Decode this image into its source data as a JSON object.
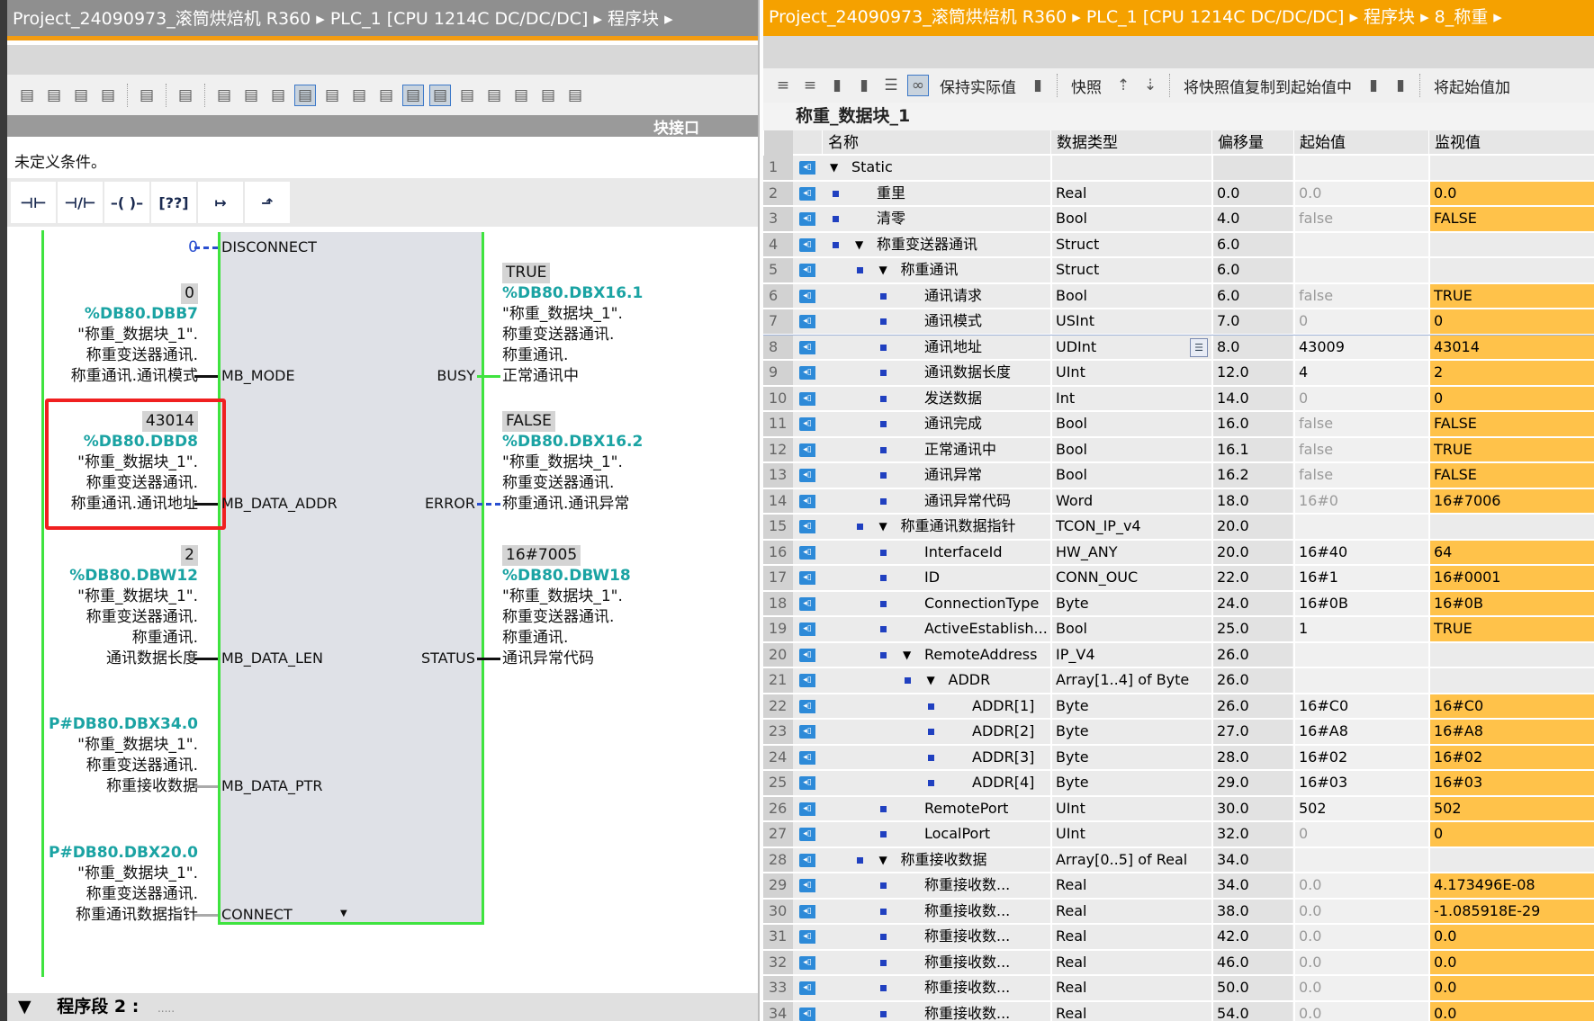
{
  "left": {
    "breadcrumb": "Project_24090973_滚筒烘焙机 R360 ▸ PLC_1 [CPU 1214C DC/DC/DC] ▸ 程序块 ▸",
    "toolbar_icons": [
      "insert-network-icon",
      "delete-network-icon",
      "insert-row-icon",
      "add-row-icon",
      "goto-icon",
      "absolute-operands-icon",
      "networks-open-icon",
      "networks-close-icon",
      "favorites-bar-icon",
      "comment-icon",
      "display-tags-icon",
      "display-comments-icon",
      "symbol-info-icon",
      "list-icon",
      "block-interface-icon",
      "jump-prev-error-icon",
      "jump-next-error-icon",
      "monitor-icon",
      "monitor-off-icon",
      "download-icon"
    ],
    "interface_label": "块接口",
    "condition_text": "未定义条件。",
    "palette": [
      {
        "icon": "no-contact-icon",
        "glyph": "⊣⊢"
      },
      {
        "icon": "nc-contact-icon",
        "glyph": "⊣/⊢"
      },
      {
        "icon": "coil-icon",
        "glyph": "–( )–"
      },
      {
        "icon": "empty-box-icon",
        "glyph": "[??]"
      },
      {
        "icon": "open-branch-icon",
        "glyph": "↦"
      },
      {
        "icon": "close-branch-icon",
        "glyph": "⬏"
      }
    ],
    "ladder": {
      "inputs": [
        {
          "pin": "DISCONNECT",
          "wire": "dashed-blue",
          "value": "0",
          "value_style": "blue",
          "address": "",
          "lines": []
        },
        {
          "pin": "MB_MODE",
          "wire": "solid",
          "value": "0",
          "address": "%DB80.DBB7",
          "lines": [
            "\"称重_数据块_1\".",
            "称重变送器通讯.",
            "称重通讯.通讯模式"
          ]
        },
        {
          "pin": "MB_DATA_ADDR",
          "wire": "solid",
          "value": "43014",
          "address": "%DB80.DBD8",
          "lines": [
            "\"称重_数据块_1\".",
            "称重变送器通讯.",
            "称重通讯.通讯地址"
          ],
          "highlighted": true
        },
        {
          "pin": "MB_DATA_LEN",
          "wire": "solid",
          "value": "2",
          "address": "%DB80.DBW12",
          "lines": [
            "\"称重_数据块_1\".",
            "称重变送器通讯.",
            "称重通讯.",
            "通讯数据长度"
          ]
        },
        {
          "pin": "MB_DATA_PTR",
          "wire": "gray",
          "value": "",
          "address": "P#DB80.DBX34.0",
          "lines": [
            "\"称重_数据块_1\".",
            "称重变送器通讯.",
            "称重接收数据"
          ]
        },
        {
          "pin": "CONNECT",
          "wire": "gray",
          "value": "",
          "address": "P#DB80.DBX20.0",
          "lines": [
            "\"称重_数据块_1\".",
            "称重变送器通讯.",
            "称重通讯数据指针"
          ]
        }
      ],
      "outputs": [
        {
          "pin": "BUSY",
          "wire": "green",
          "value": "TRUE",
          "address": "%DB80.DBX16.1",
          "lines": [
            "\"称重_数据块_1\".",
            "称重变送器通讯.",
            "称重通讯.",
            "正常通讯中"
          ]
        },
        {
          "pin": "ERROR",
          "wire": "dashed-blue",
          "value": "FALSE",
          "address": "%DB80.DBX16.2",
          "lines": [
            "\"称重_数据块_1\".",
            "称重变送器通讯.",
            "称重通讯.通讯异常"
          ]
        },
        {
          "pin": "STATUS",
          "wire": "solid",
          "value": "16#7005",
          "address": "%DB80.DBW18",
          "lines": [
            "\"称重_数据块_1\".",
            "称重变送器通讯.",
            "称重通讯.",
            "通讯异常代码"
          ]
        }
      ]
    },
    "next_segment": "程序段 2 :",
    "next_segment_comment": "....."
  },
  "right": {
    "breadcrumb": "Project_24090973_滚筒烘焙机 R360 ▸ PLC_1 [CPU 1214C DC/DC/DC] ▸ 程序块 ▸ 8_称重 ▸",
    "toolbar": {
      "keep_actual": "保持实际值",
      "snapshot": "快照",
      "copy_snapshot": "将快照值复制到起始值中",
      "load_start": "将起始值加"
    },
    "db_title": "称重_数据块_1",
    "columns": [
      "名称",
      "数据类型",
      "偏移量",
      "起始值",
      "监视值"
    ],
    "rows": [
      {
        "n": "1",
        "level": 0,
        "bullet": false,
        "expand": true,
        "name": "Static",
        "type": "",
        "offset": "",
        "start": "",
        "monitor": ""
      },
      {
        "n": "2",
        "level": 1,
        "bullet": true,
        "name": "重里",
        "type": "Real",
        "offset": "0.0",
        "start": "0.0",
        "start_default": true,
        "monitor": "0.0"
      },
      {
        "n": "3",
        "level": 1,
        "bullet": true,
        "name": "清零",
        "type": "Bool",
        "offset": "4.0",
        "start": "false",
        "start_default": true,
        "monitor": "FALSE"
      },
      {
        "n": "4",
        "level": 1,
        "bullet": true,
        "expand": true,
        "name": "称重变送器通讯",
        "type": "Struct",
        "offset": "6.0",
        "start": "",
        "monitor": ""
      },
      {
        "n": "5",
        "level": 2,
        "bullet": true,
        "expand": true,
        "name": "称重通讯",
        "type": "Struct",
        "offset": "6.0",
        "start": "",
        "monitor": ""
      },
      {
        "n": "6",
        "level": 3,
        "bullet": true,
        "name": "通讯请求",
        "type": "Bool",
        "offset": "6.0",
        "start": "false",
        "start_default": true,
        "monitor": "TRUE"
      },
      {
        "n": "7",
        "level": 3,
        "bullet": true,
        "name": "通讯模式",
        "type": "USInt",
        "offset": "7.0",
        "start": "0",
        "start_default": true,
        "monitor": "0"
      },
      {
        "n": "8",
        "level": 3,
        "bullet": true,
        "name": "通讯地址",
        "type": "UDInt",
        "offset": "8.0",
        "start": "43009",
        "monitor": "43014",
        "selected": true
      },
      {
        "n": "9",
        "level": 3,
        "bullet": true,
        "name": "通讯数据长度",
        "type": "UInt",
        "offset": "12.0",
        "start": "4",
        "monitor": "2"
      },
      {
        "n": "10",
        "level": 3,
        "bullet": true,
        "name": "发送数据",
        "type": "Int",
        "offset": "14.0",
        "start": "0",
        "start_default": true,
        "monitor": "0"
      },
      {
        "n": "11",
        "level": 3,
        "bullet": true,
        "name": "通讯完成",
        "type": "Bool",
        "offset": "16.0",
        "start": "false",
        "start_default": true,
        "monitor": "FALSE"
      },
      {
        "n": "12",
        "level": 3,
        "bullet": true,
        "name": "正常通讯中",
        "type": "Bool",
        "offset": "16.1",
        "start": "false",
        "start_default": true,
        "monitor": "TRUE"
      },
      {
        "n": "13",
        "level": 3,
        "bullet": true,
        "name": "通讯异常",
        "type": "Bool",
        "offset": "16.2",
        "start": "false",
        "start_default": true,
        "monitor": "FALSE"
      },
      {
        "n": "14",
        "level": 3,
        "bullet": true,
        "name": "通讯异常代码",
        "type": "Word",
        "offset": "18.0",
        "start": "16#0",
        "start_default": true,
        "monitor": "16#7006"
      },
      {
        "n": "15",
        "level": 2,
        "bullet": true,
        "expand": true,
        "name": "称重通讯数据指针",
        "type": "TCON_IP_v4",
        "offset": "20.0",
        "start": "",
        "monitor": ""
      },
      {
        "n": "16",
        "level": 3,
        "bullet": true,
        "name": "InterfaceId",
        "type": "HW_ANY",
        "offset": "20.0",
        "start": "16#40",
        "monitor": "64"
      },
      {
        "n": "17",
        "level": 3,
        "bullet": true,
        "name": "ID",
        "type": "CONN_OUC",
        "offset": "22.0",
        "start": "16#1",
        "monitor": "16#0001"
      },
      {
        "n": "18",
        "level": 3,
        "bullet": true,
        "name": "ConnectionType",
        "type": "Byte",
        "offset": "24.0",
        "start": "16#0B",
        "monitor": "16#0B"
      },
      {
        "n": "19",
        "level": 3,
        "bullet": true,
        "name": "ActiveEstablish...",
        "type": "Bool",
        "offset": "25.0",
        "start": "1",
        "monitor": "TRUE"
      },
      {
        "n": "20",
        "level": 3,
        "bullet": true,
        "expand": true,
        "name": "RemoteAddress",
        "type": "IP_V4",
        "offset": "26.0",
        "start": "",
        "monitor": ""
      },
      {
        "n": "21",
        "level": 4,
        "bullet": true,
        "expand": true,
        "name": "ADDR",
        "type": "Array[1..4] of Byte",
        "offset": "26.0",
        "start": "",
        "monitor": ""
      },
      {
        "n": "22",
        "level": 5,
        "bullet": true,
        "name": "ADDR[1]",
        "type": "Byte",
        "offset": "26.0",
        "start": "16#C0",
        "monitor": "16#C0"
      },
      {
        "n": "23",
        "level": 5,
        "bullet": true,
        "name": "ADDR[2]",
        "type": "Byte",
        "offset": "27.0",
        "start": "16#A8",
        "monitor": "16#A8"
      },
      {
        "n": "24",
        "level": 5,
        "bullet": true,
        "name": "ADDR[3]",
        "type": "Byte",
        "offset": "28.0",
        "start": "16#02",
        "monitor": "16#02"
      },
      {
        "n": "25",
        "level": 5,
        "bullet": true,
        "name": "ADDR[4]",
        "type": "Byte",
        "offset": "29.0",
        "start": "16#03",
        "monitor": "16#03"
      },
      {
        "n": "26",
        "level": 3,
        "bullet": true,
        "name": "RemotePort",
        "type": "UInt",
        "offset": "30.0",
        "start": "502",
        "monitor": "502"
      },
      {
        "n": "27",
        "level": 3,
        "bullet": true,
        "name": "LocalPort",
        "type": "UInt",
        "offset": "32.0",
        "start": "0",
        "start_default": true,
        "monitor": "0"
      },
      {
        "n": "28",
        "level": 2,
        "bullet": true,
        "expand": true,
        "name": "称重接收数据",
        "type": "Array[0..5] of Real",
        "offset": "34.0",
        "start": "",
        "monitor": ""
      },
      {
        "n": "29",
        "level": 3,
        "bullet": true,
        "name": "称重接收数...",
        "type": "Real",
        "offset": "34.0",
        "start": "0.0",
        "start_default": true,
        "monitor": "4.173496E-08"
      },
      {
        "n": "30",
        "level": 3,
        "bullet": true,
        "name": "称重接收数...",
        "type": "Real",
        "offset": "38.0",
        "start": "0.0",
        "start_default": true,
        "monitor": "-1.085918E-29"
      },
      {
        "n": "31",
        "level": 3,
        "bullet": true,
        "name": "称重接收数...",
        "type": "Real",
        "offset": "42.0",
        "start": "0.0",
        "start_default": true,
        "monitor": "0.0"
      },
      {
        "n": "32",
        "level": 3,
        "bullet": true,
        "name": "称重接收数...",
        "type": "Real",
        "offset": "46.0",
        "start": "0.0",
        "start_default": true,
        "monitor": "0.0"
      },
      {
        "n": "33",
        "level": 3,
        "bullet": true,
        "name": "称重接收数...",
        "type": "Real",
        "offset": "50.0",
        "start": "0.0",
        "start_default": true,
        "monitor": "0.0"
      },
      {
        "n": "34",
        "level": 3,
        "bullet": true,
        "name": "称重接收数...",
        "type": "Real",
        "offset": "54.0",
        "start": "0.0",
        "start_default": true,
        "monitor": "0.0"
      }
    ]
  },
  "colors": {
    "accent_orange": "#f5a100",
    "monitor_cell": "#ffc24a",
    "address_teal": "#1aa3a3",
    "power_flow_green": "#3fe33f",
    "highlight_red": "#f02020"
  }
}
